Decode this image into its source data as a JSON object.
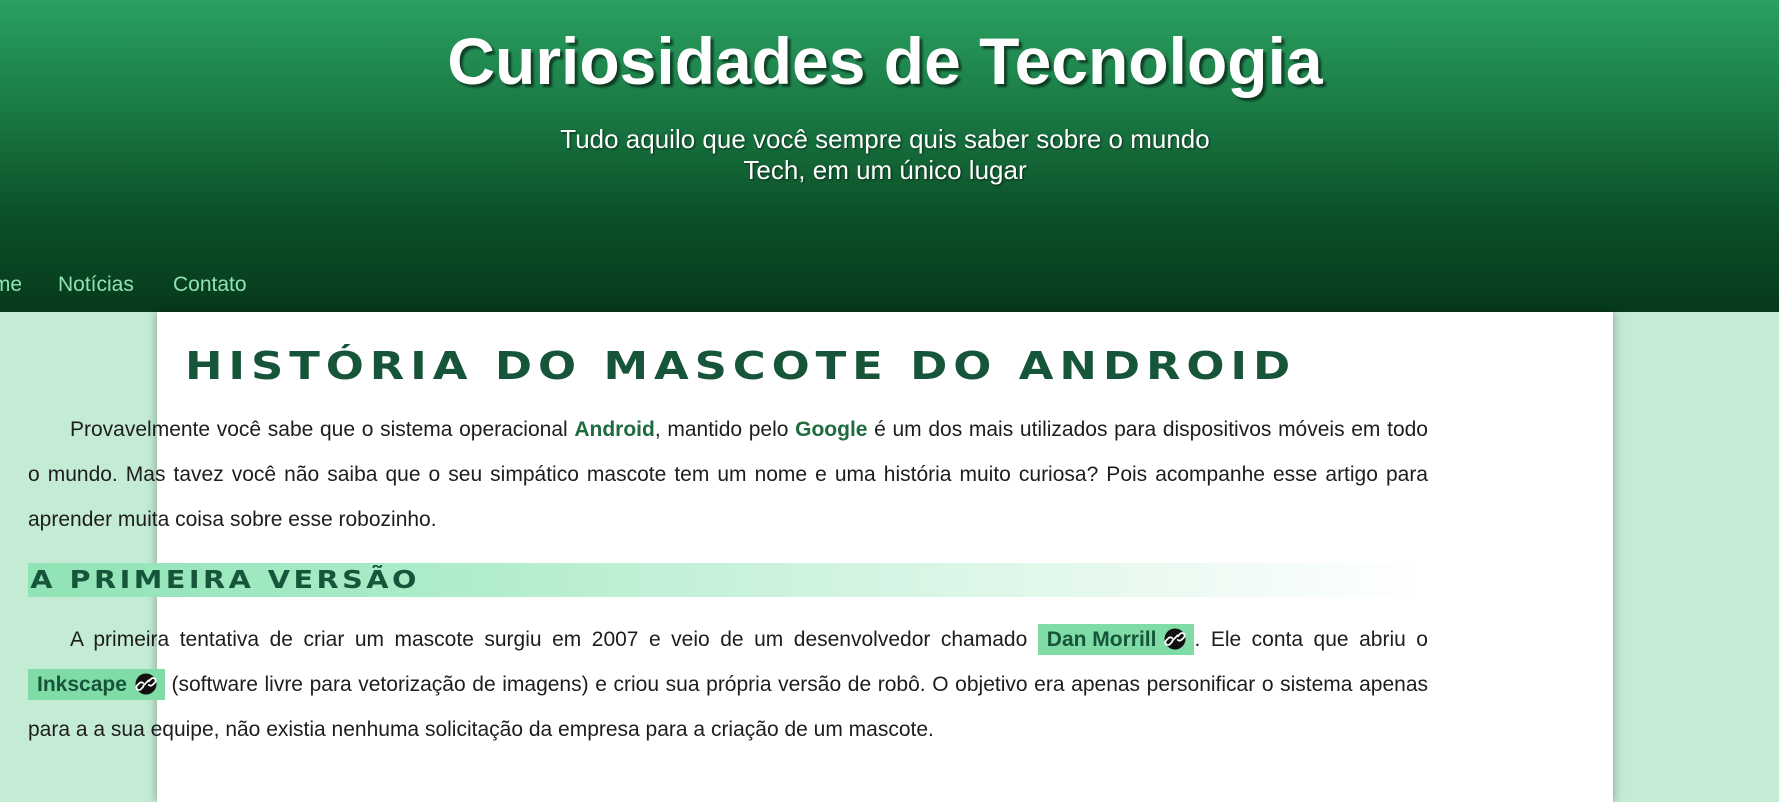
{
  "header": {
    "title": "Curiosidades de Tecnologia",
    "subtitle_line1": "Tudo aquilo que você sempre quis saber sobre o mundo",
    "subtitle_line2": "Tech, em um único lugar"
  },
  "nav": {
    "items": [
      {
        "label": "Home"
      },
      {
        "label": "Notícias"
      },
      {
        "label": "Contato"
      }
    ]
  },
  "article": {
    "title": "História do Mascote do Android",
    "intro": {
      "part1": "Provavelmente você sabe que o sistema operacional ",
      "android": "Android",
      "part2": ", mantido pelo ",
      "google": "Google",
      "part3": " é um dos mais utilizados para dispositivos móveis em todo o mundo. Mas tavez você não saiba que o seu simpático mascote tem um nome e uma história muito curiosa? Pois acompanhe esse artigo para aprender muita coisa sobre esse robozinho."
    },
    "section1": {
      "heading": "A Primeira Versão",
      "part1": "A primeira tentativa de criar um mascote surgiu em 2007 e veio de um desenvolvedor chamado ",
      "link1": "Dan Morrill",
      "part2": ". Ele conta que abriu o ",
      "link2": "Inkscape",
      "part3": " (software livre para vetorização de imagens) e criou sua própria versão de robô. O objetivo era apenas personificar o sistema apenas para a a sua equipe, não existia nenhuma solicitação da empresa para a criação de um mascote."
    }
  },
  "icons": {
    "external_link": "link-icon"
  },
  "colors": {
    "header_top": "#2aa062",
    "header_bottom": "#063a1c",
    "page_background": "#c4ecd5",
    "link_highlight": "#7fdca7",
    "heading_green": "#17553a"
  }
}
